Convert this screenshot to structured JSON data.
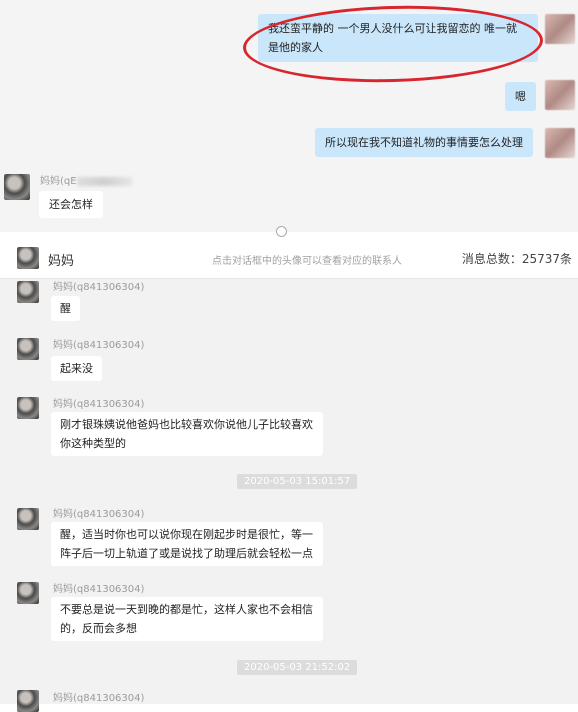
{
  "top": {
    "message_1": "我还蛮平静的 一个男人没什么可让我留恋的 唯一就是他的家人",
    "message_1_line1": "我还蛮平静的 一个男人没什么可让我留恋的 唯一就",
    "message_1_line2": "是他的家人",
    "message_2": "嗯",
    "message_3": "所以现在我不知道礼物的事情要怎么处理",
    "sender_name": "妈妈(qE",
    "reply": "还会怎样",
    "highlight_color": "#d7262e"
  },
  "bottom": {
    "contact_name": "妈妈",
    "hint": "点击对话框中的头像可以查看对应的联系人",
    "total": "消息总数：25737条",
    "messages": [
      {
        "sender": "妈妈(q841306304)",
        "text": "醒"
      },
      {
        "sender": "妈妈(q841306304)",
        "text": "起来没"
      },
      {
        "sender": "妈妈(q841306304)",
        "line1": "刚才银珠姨说他爸妈也比较喜欢你说他儿子比较喜欢",
        "line2": "你这种类型的"
      },
      {
        "sender": "妈妈(q841306304)",
        "line1": "醒，适当时你也可以说你现在刚起步时是很忙，等一",
        "line2": "阵子后一切上轨道了或是说找了助理后就会轻松一点"
      },
      {
        "sender": "妈妈(q841306304)",
        "line1": "不要总是说一天到晚的都是忙，这样人家也不会相信",
        "line2": "的，反而会多想"
      },
      {
        "sender": "妈妈(q841306304)"
      }
    ],
    "timestamps": [
      "2020-05-03 15:01:57",
      "2020-05-03 21:52:02"
    ]
  },
  "colors": {
    "sent_bubble": "#c9e6fb",
    "received_bubble": "#ffffff",
    "background": "#f2f2f2"
  }
}
